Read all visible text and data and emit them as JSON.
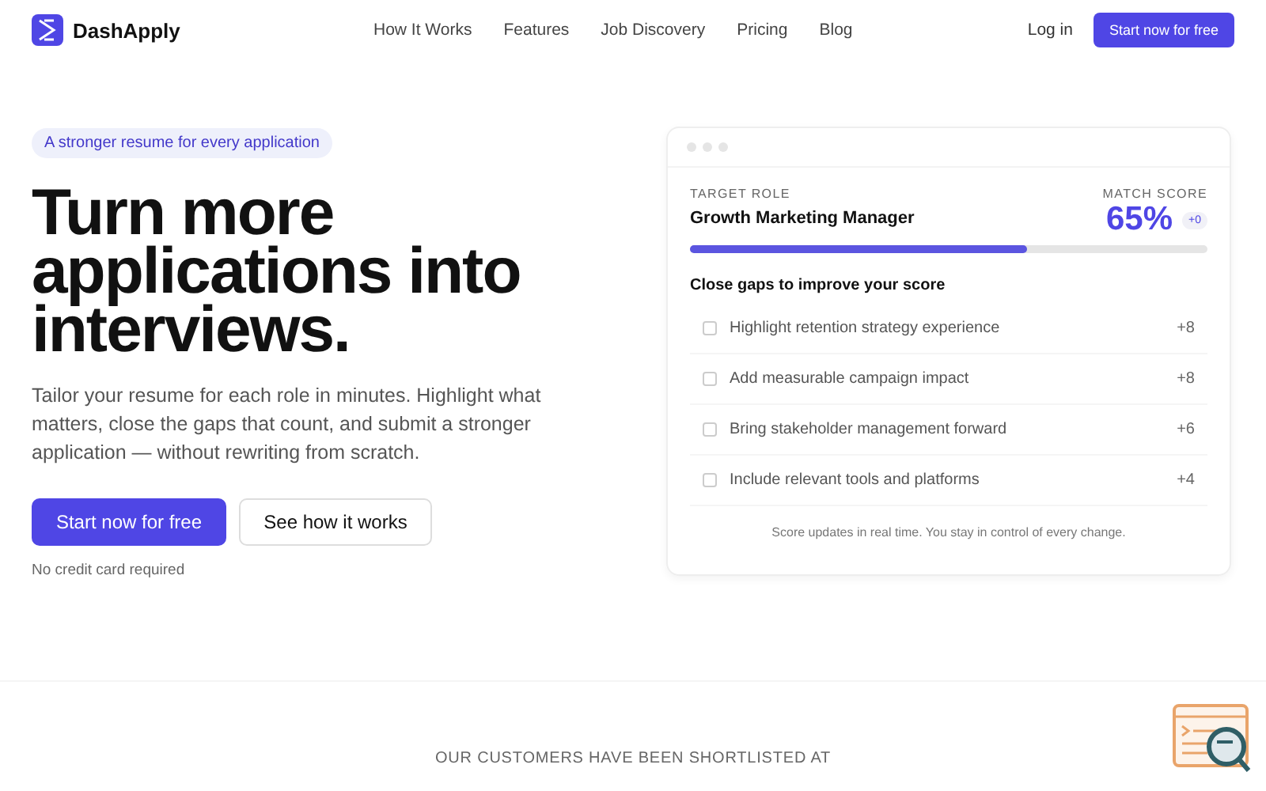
{
  "brand": {
    "name": "DashApply"
  },
  "nav": {
    "links": [
      "How It Works",
      "Features",
      "Job Discovery",
      "Pricing",
      "Blog"
    ],
    "login": "Log in",
    "cta": "Start now for free"
  },
  "hero": {
    "badge": "A stronger resume for every application",
    "headline": "Turn more applications into interviews.",
    "subtitle": "Tailor your resume for each role in minutes. Highlight what matters, close the gaps that count, and submit a stronger application — without rewriting from scratch.",
    "primary_button": "Start now for free",
    "secondary_button": "See how it works",
    "note": "No credit card required"
  },
  "card": {
    "role_label": "TARGET ROLE",
    "role": "Growth Marketing Manager",
    "score_label": "MATCH SCORE",
    "score": "65%",
    "delta": "+0",
    "level": 0.65,
    "gaps_title": "Close gaps to improve your score",
    "gaps": [
      {
        "label": "Highlight retention strategy experience",
        "points": "+8",
        "checked": false
      },
      {
        "label": "Add measurable campaign impact",
        "points": "+8",
        "checked": false
      },
      {
        "label": "Bring stakeholder management forward",
        "points": "+6",
        "checked": false
      },
      {
        "label": "Include relevant tools and platforms",
        "points": "+4",
        "checked": false
      }
    ],
    "footnote": "Score updates in real time. You stay in control of every change."
  },
  "customers": {
    "heading": "OUR CUSTOMERS HAVE BEEN SHORTLISTED AT"
  }
}
